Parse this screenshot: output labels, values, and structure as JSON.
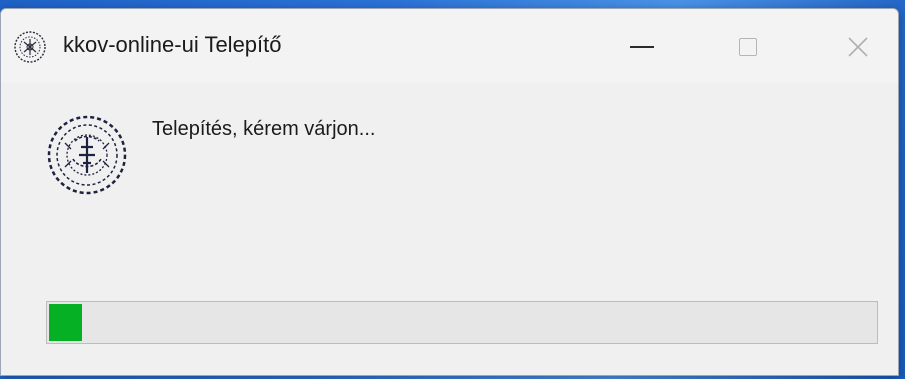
{
  "window": {
    "title": "kkov-online-ui Telepítő",
    "icon": "seal-logo-icon",
    "controls": {
      "minimize_icon": "minimize-icon",
      "maximize_icon": "maximize-icon",
      "close_icon": "close-icon",
      "close_glyph": "✕"
    }
  },
  "body": {
    "message": "Telepítés, kérem várjon...",
    "icon": "seal-logo-icon"
  },
  "progress": {
    "fraction": 0.04,
    "color": "#06b025"
  }
}
